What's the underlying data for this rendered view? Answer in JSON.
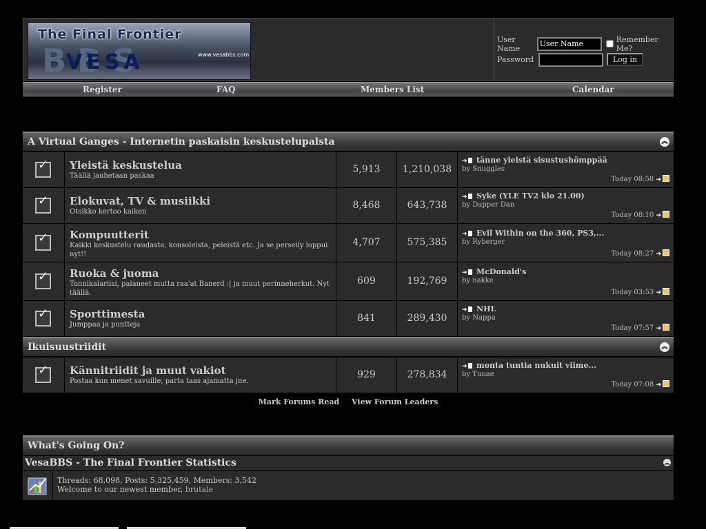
{
  "header": {
    "logo": {
      "title": "The Final Frontier",
      "big": "BBS",
      "sub": "VESA",
      "url": "www.vesabbs.com"
    },
    "login": {
      "username_label": "User Name",
      "username_value": "User Name",
      "password_label": "Password",
      "remember_label": "Remember Me?",
      "login_button": "Log in"
    }
  },
  "navbar": {
    "register": "Register",
    "faq": "FAQ",
    "members": "Members List",
    "calendar": "Calendar"
  },
  "categories": [
    {
      "title": "A Virtual Ganges - Internetin paskaisin keskustelupalsta",
      "forums": [
        {
          "name": "Yleistä keskustelua",
          "desc": "Täällä jauhetaan paskaa",
          "threads": "5,913",
          "posts": "1,210,038",
          "last_title": "tänne yleistä sisustushömppää",
          "last_by": "by",
          "last_user": "Snuggles",
          "last_time": "Today 08:58"
        },
        {
          "name": "Elokuvat, TV & musiikki",
          "desc": "Otsikko kertoo kaiken",
          "threads": "8,468",
          "posts": "643,738",
          "last_title": "Syke (YLE TV2 klo 21.00)",
          "last_by": "by",
          "last_user": "Dapper Dan",
          "last_time": "Today 08:10"
        },
        {
          "name": "Kompuutterit",
          "desc": "Kaikki keskustelu raudasta, konsoleista, peleistä etc. Ja se perseily loppui nyt!!",
          "threads": "4,707",
          "posts": "575,385",
          "last_title": "Evil Within on the 360, PS3,...",
          "last_by": "by",
          "last_user": "Ryberger",
          "last_time": "Today 08:27"
        },
        {
          "name": "Ruoka & juoma",
          "desc": "Tonnikalariisi, palaneet mutta raa'at Banerd :| ja muut perinneherkut. Nyt täällä.",
          "threads": "609",
          "posts": "192,769",
          "last_title": "McDonald's",
          "last_by": "by",
          "last_user": "nakke",
          "last_time": "Today 03:53"
        },
        {
          "name": "Sporttimesta",
          "desc": "Jumppaa ja puntteja",
          "threads": "841",
          "posts": "289,430",
          "last_title": "NHL",
          "last_by": "by",
          "last_user": "Nappa",
          "last_time": "Today 07:57"
        }
      ]
    },
    {
      "title": "Ikuisuustriidit",
      "forums": [
        {
          "name": "Kännitriidit ja muut vakiot",
          "desc": "Postaa kun menet savuille, parta taas ajamatta jne.",
          "threads": "929",
          "posts": "278,834",
          "last_title": "monta tuntia nukuit viime...",
          "last_by": "by",
          "last_user": "Tunae",
          "last_time": "Today 07:08"
        }
      ]
    }
  ],
  "links": {
    "mark_read": "Mark Forums Read",
    "leaders": "View Forum Leaders"
  },
  "wgo": {
    "title": "What's Going On?",
    "stats_title": "VesaBBS - The Final Frontier Statistics",
    "stats_line": "Threads: 68,098, Posts: 5,325,459, Members: 3,542",
    "welcome": "Welcome to our newest member,",
    "newest": "brutale"
  }
}
